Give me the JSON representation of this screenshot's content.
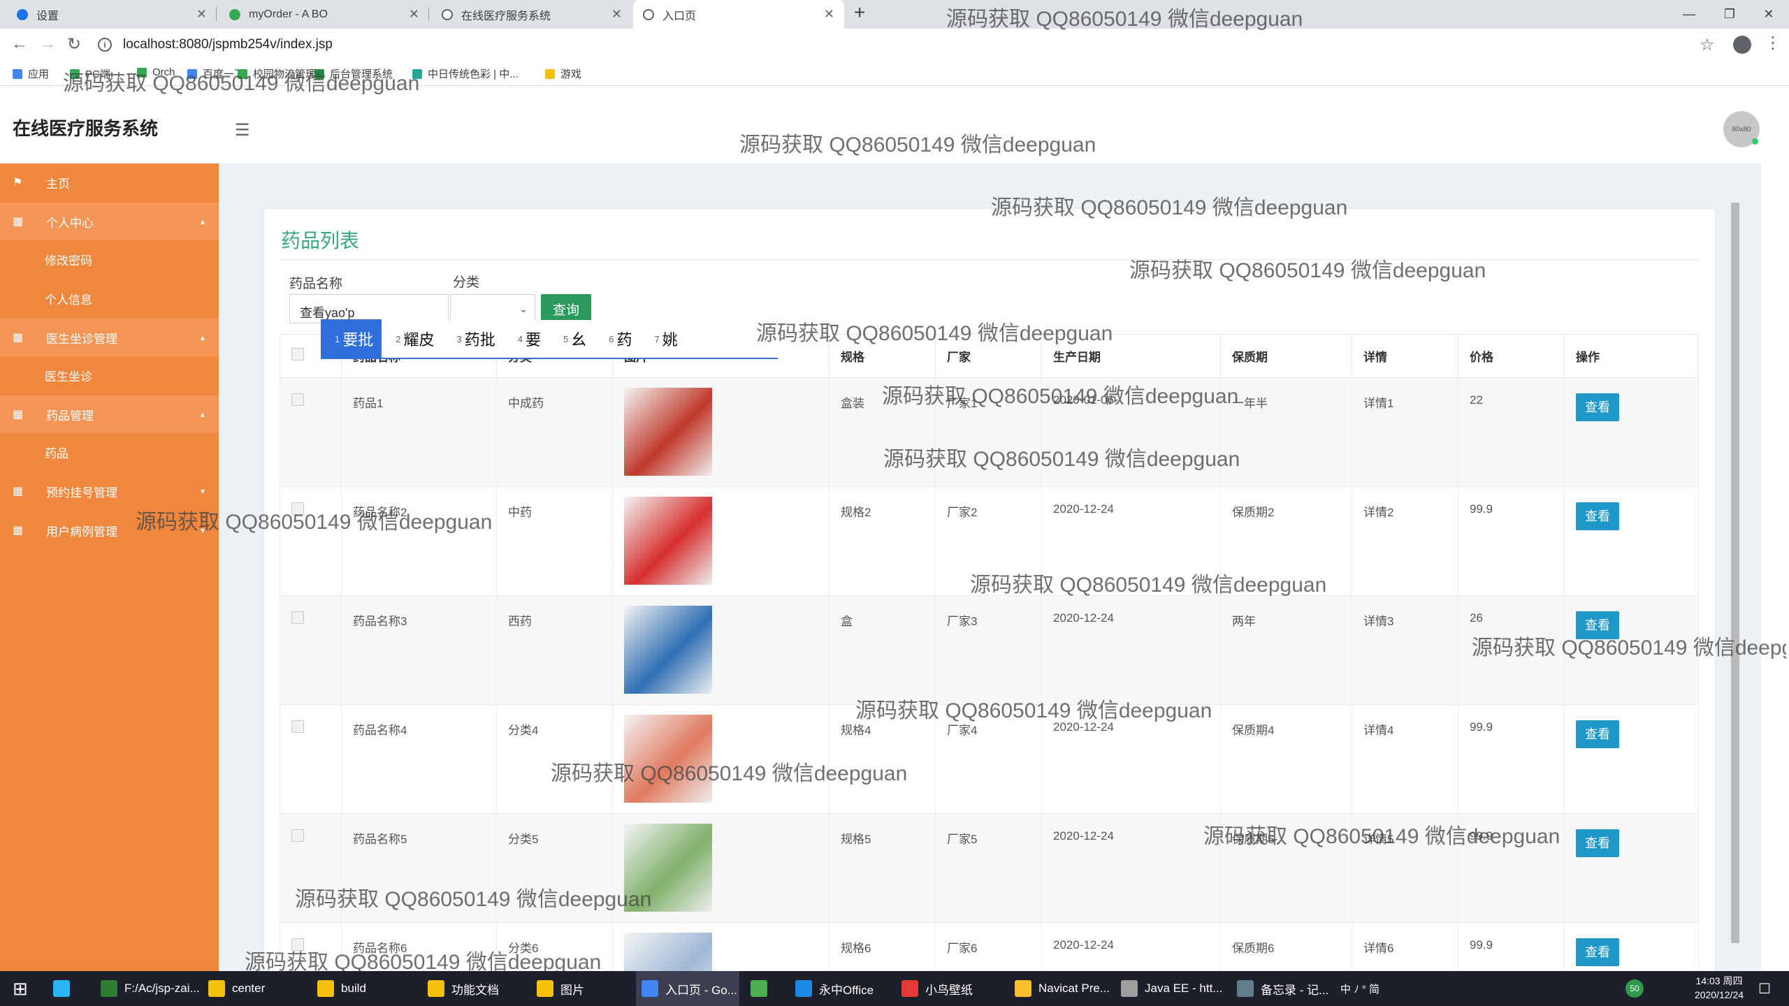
{
  "browser": {
    "tabs": [
      {
        "label": "设置",
        "icon_color": "#1a73e8"
      },
      {
        "label": "myOrder - A BO",
        "icon_color": "#34a853"
      },
      {
        "label": "在线医疗服务系统",
        "icon_color": "#5f6368"
      },
      {
        "label": "入口页",
        "icon_color": "#5f6368"
      }
    ],
    "url": "localhost:8080/jspmb254v/index.jsp",
    "bookmarks": [
      {
        "label": "应用",
        "color": "#4285f4"
      },
      {
        "label": "PC端",
        "color": "#34a853"
      },
      {
        "label": "Orch",
        "color": "#34a853"
      },
      {
        "label": "百度一下",
        "color": "#4285f4"
      },
      {
        "label": "校园物流管理",
        "color": "#34a853"
      },
      {
        "label": "后台管理系统",
        "color": "#1e8e3e"
      },
      {
        "label": "中日传统色彩 | 中...",
        "color": "#26a69a"
      },
      {
        "label": "游戏",
        "color": "#f4c20d"
      }
    ]
  },
  "app": {
    "title": "在线医疗服务系统",
    "avatar_text": "80x80",
    "sidebar": {
      "home": "主页",
      "personal_center": "个人中心",
      "change_password": "修改密码",
      "personal_info": "个人信息",
      "doctor_mgmt": "医生坐诊管理",
      "doctor": "医生坐诊",
      "drug_mgmt": "药品管理",
      "drug": "药品",
      "appointment_mgmt": "预约挂号管理",
      "record_mgmt": "用户病例管理"
    },
    "page_title": "药品列表",
    "search": {
      "name_label": "药品名称",
      "name_value": "查看yao'p",
      "category_label": "分类",
      "category_value": "",
      "query_button": "查询"
    },
    "ime_candidates": [
      {
        "n": "1",
        "text": "要批"
      },
      {
        "n": "2",
        "text": "耀皮"
      },
      {
        "n": "3",
        "text": "药批"
      },
      {
        "n": "4",
        "text": "要"
      },
      {
        "n": "5",
        "text": "幺"
      },
      {
        "n": "6",
        "text": "药"
      },
      {
        "n": "7",
        "text": "姚"
      }
    ],
    "table": {
      "headers": [
        "药品名称",
        "分类",
        "图片",
        "规格",
        "厂家",
        "生产日期",
        "保质期",
        "详情",
        "价格",
        "操作"
      ],
      "view_label": "查看",
      "rows": [
        {
          "name": "药品1",
          "category": "中成药",
          "spec": "盒装",
          "maker": "厂家1",
          "date": "2020-01-06",
          "shelf": "一年半",
          "detail": "详情1",
          "price": "22",
          "img": "#c0392b"
        },
        {
          "name": "药品名称2",
          "category": "中药",
          "spec": "规格2",
          "maker": "厂家2",
          "date": "2020-12-24",
          "shelf": "保质期2",
          "detail": "详情2",
          "price": "99.9",
          "img": "#d62f2f"
        },
        {
          "name": "药品名称3",
          "category": "西药",
          "spec": "盒",
          "maker": "厂家3",
          "date": "2020-12-24",
          "shelf": "两年",
          "detail": "详情3",
          "price": "26",
          "img": "#2f6fb3"
        },
        {
          "name": "药品名称4",
          "category": "分类4",
          "spec": "规格4",
          "maker": "厂家4",
          "date": "2020-12-24",
          "shelf": "保质期4",
          "detail": "详情4",
          "price": "99.9",
          "img": "#e07a5f"
        },
        {
          "name": "药品名称5",
          "category": "分类5",
          "spec": "规格5",
          "maker": "厂家5",
          "date": "2020-12-24",
          "shelf": "保质期5",
          "detail": "详情5",
          "price": "99.9",
          "img": "#7fb069"
        },
        {
          "name": "药品名称6",
          "category": "分类6",
          "spec": "规格6",
          "maker": "厂家6",
          "date": "2020-12-24",
          "shelf": "保质期6",
          "detail": "详情6",
          "price": "99.9",
          "img": "#9fb8d6"
        }
      ]
    }
  },
  "watermark": "源码获取 QQ86050149 微信deepguan",
  "taskbar": {
    "items": [
      "F:/Ac/jsp-zai...",
      "center",
      "build",
      "功能文档",
      "图片",
      "入口页 - Go...",
      "",
      "永中Office",
      "小鸟壁纸",
      "Navicat Pre...",
      "Java EE - htt...",
      "备忘录 - 记..."
    ],
    "tray": "中 ﾉ ° 简",
    "time": "14:03 周四",
    "date": "2020/12/24"
  }
}
